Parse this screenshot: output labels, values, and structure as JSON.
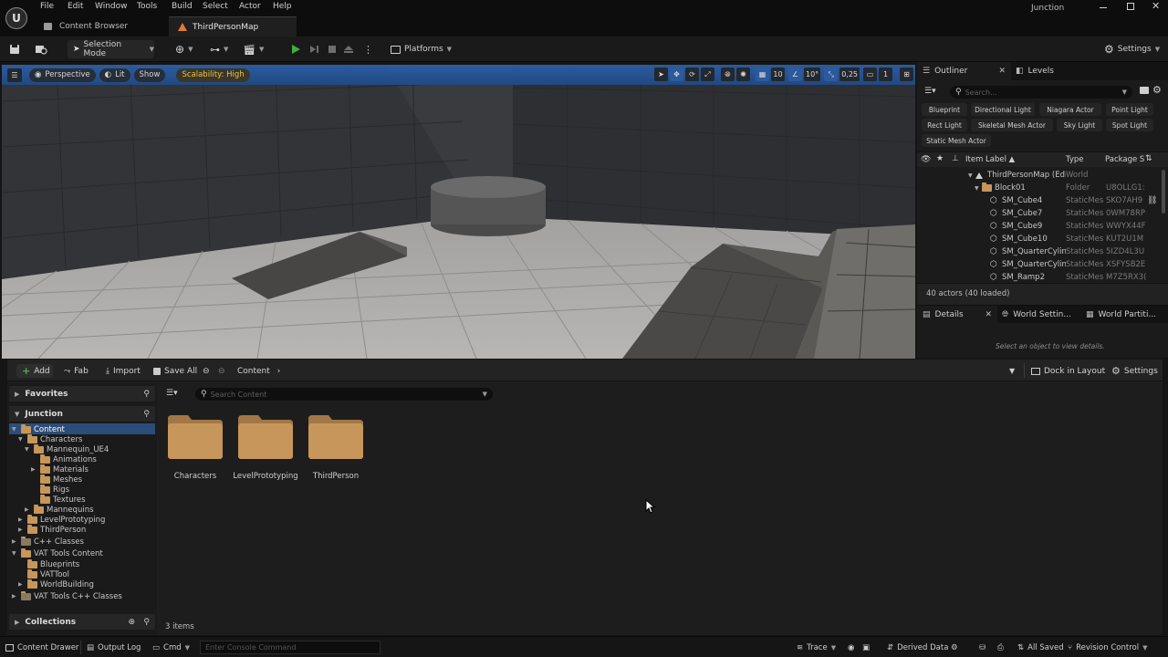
{
  "menu": [
    "File",
    "Edit",
    "Window",
    "Tools",
    "Build",
    "Select",
    "Actor",
    "Help"
  ],
  "project_name": "Junction",
  "tabs": {
    "content_browser": "Content Browser",
    "map": "ThirdPersonMap"
  },
  "toolbar": {
    "selection_mode": "Selection Mode",
    "platforms": "Platforms",
    "settings": "Settings"
  },
  "viewport": {
    "perspective": "Perspective",
    "lit": "Lit",
    "show": "Show",
    "scalability": "Scalability: High",
    "grid_snap": "10",
    "rotation_snap": "10°",
    "scale_snap": "0,25",
    "camera_speed": "1"
  },
  "outliner": {
    "title": "Outliner",
    "levels_tab": "Levels",
    "search_placeholder": "Search...",
    "filters": [
      "Blueprint",
      "Directional Light",
      "Niagara Actor",
      "Point Light",
      "Rect Light",
      "Skeletal Mesh Actor",
      "Sky Light",
      "Spot Light",
      "Static Mesh Actor"
    ],
    "columns": {
      "label": "Item Label ▲",
      "type": "Type",
      "package": "Package S"
    },
    "rows": [
      {
        "label": "ThirdPersonMap (Edi",
        "type": "World",
        "package": ""
      },
      {
        "label": "Block01",
        "type": "Folder",
        "package": "U8OLLG1:"
      },
      {
        "label": "SM_Cube4",
        "type": "StaticMes",
        "package": "SKO7AH9"
      },
      {
        "label": "SM_Cube7",
        "type": "StaticMes",
        "package": "0WM78RP"
      },
      {
        "label": "SM_Cube9",
        "type": "StaticMes",
        "package": "WWYX44F"
      },
      {
        "label": "SM_Cube10",
        "type": "StaticMes",
        "package": "KUT2U1M"
      },
      {
        "label": "SM_QuarterCylin",
        "type": "StaticMes",
        "package": "5IZD4L3U"
      },
      {
        "label": "SM_QuarterCylin",
        "type": "StaticMes",
        "package": "XSFYSB2E"
      },
      {
        "label": "SM_Ramp2",
        "type": "StaticMes",
        "package": "M7Z5RX3("
      }
    ],
    "actor_count": "40 actors (40 loaded)"
  },
  "details": {
    "title": "Details",
    "world_settings": "World Settin...",
    "world_partition": "World Partiti...",
    "empty_msg": "Select an object to view details."
  },
  "content_browser": {
    "add": "Add",
    "fab": "Fab",
    "import": "Import",
    "save_all": "Save All",
    "path": "Content",
    "dock": "Dock in Layout",
    "settings": "Settings",
    "search_placeholder": "Search Content",
    "favorites": "Favorites",
    "project": "Junction",
    "collections": "Collections",
    "item_count": "3 items",
    "tree": [
      {
        "label": "Content",
        "depth": 0,
        "open": true
      },
      {
        "label": "Characters",
        "depth": 1,
        "open": true
      },
      {
        "label": "Mannequin_UE4",
        "depth": 2,
        "open": true
      },
      {
        "label": "Animations",
        "depth": 3,
        "open": false
      },
      {
        "label": "Materials",
        "depth": 3,
        "open": false
      },
      {
        "label": "Meshes",
        "depth": 3,
        "open": false
      },
      {
        "label": "Rigs",
        "depth": 3,
        "open": false
      },
      {
        "label": "Textures",
        "depth": 3,
        "open": false
      },
      {
        "label": "Mannequins",
        "depth": 2,
        "open": false
      },
      {
        "label": "LevelPrototyping",
        "depth": 1,
        "open": false
      },
      {
        "label": "ThirdPerson",
        "depth": 1,
        "open": false
      },
      {
        "label": "C++ Classes",
        "depth": 0,
        "open": false
      },
      {
        "label": "VAT Tools Content",
        "depth": 0,
        "open": true
      },
      {
        "label": "Blueprints",
        "depth": 1,
        "open": false
      },
      {
        "label": "VATTool",
        "depth": 1,
        "open": false
      },
      {
        "label": "WorldBuilding",
        "depth": 1,
        "open": false
      },
      {
        "label": "VAT Tools C++ Classes",
        "depth": 0,
        "open": false
      }
    ],
    "folders": [
      "Characters",
      "LevelPrototyping",
      "ThirdPerson"
    ]
  },
  "statusbar": {
    "content_drawer": "Content Drawer",
    "output_log": "Output Log",
    "cmd": "Cmd",
    "console_placeholder": "Enter Console Command",
    "trace": "Trace",
    "derived_data": "Derived Data",
    "all_saved": "All Saved",
    "revision_control": "Revision Control"
  },
  "colors": {
    "accent": "#2c5a9c",
    "folder": "#c7965a",
    "play": "#3fae3f",
    "scalability": "#e9c44a"
  }
}
